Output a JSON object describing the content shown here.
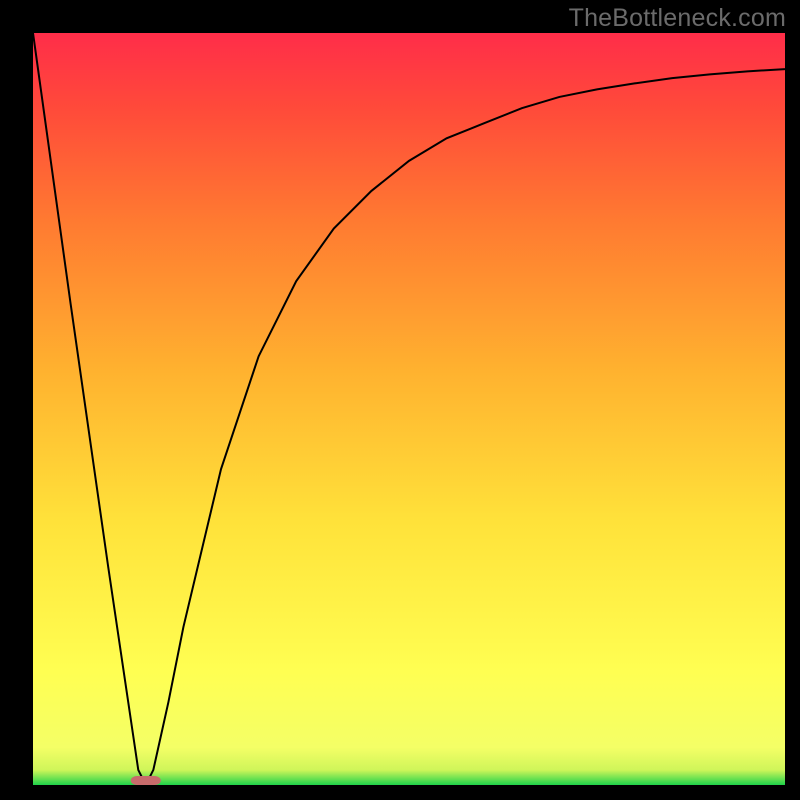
{
  "watermark": "TheBottleneck.com",
  "chart_data": {
    "type": "line",
    "title": "",
    "xlabel": "",
    "ylabel": "",
    "xlim": [
      0,
      100
    ],
    "ylim": [
      0,
      100
    ],
    "x": [
      0,
      5,
      10,
      14,
      15,
      16,
      18,
      20,
      25,
      30,
      35,
      40,
      45,
      50,
      55,
      60,
      65,
      70,
      75,
      80,
      85,
      90,
      95,
      100
    ],
    "values": [
      100,
      64,
      29,
      2,
      0,
      2,
      11,
      21,
      42,
      57,
      67,
      74,
      79,
      83,
      86,
      88,
      90,
      91.5,
      92.5,
      93.3,
      94,
      94.5,
      94.9,
      95.2
    ],
    "marker": {
      "x": 15,
      "y_low": 0,
      "y_high": 1.2
    },
    "gradient_stops": [
      {
        "offset": 0,
        "color": "#1fd24a"
      },
      {
        "offset": 2,
        "color": "#cff55a"
      },
      {
        "offset": 5,
        "color": "#f4ff66"
      },
      {
        "offset": 15,
        "color": "#ffff52"
      },
      {
        "offset": 35,
        "color": "#ffe23a"
      },
      {
        "offset": 55,
        "color": "#ffb22f"
      },
      {
        "offset": 75,
        "color": "#ff7a31"
      },
      {
        "offset": 90,
        "color": "#ff4a3a"
      },
      {
        "offset": 100,
        "color": "#ff2d49"
      }
    ],
    "marker_color": "#c76b6b",
    "line_color": "#000000",
    "frame_color": "#000000"
  }
}
